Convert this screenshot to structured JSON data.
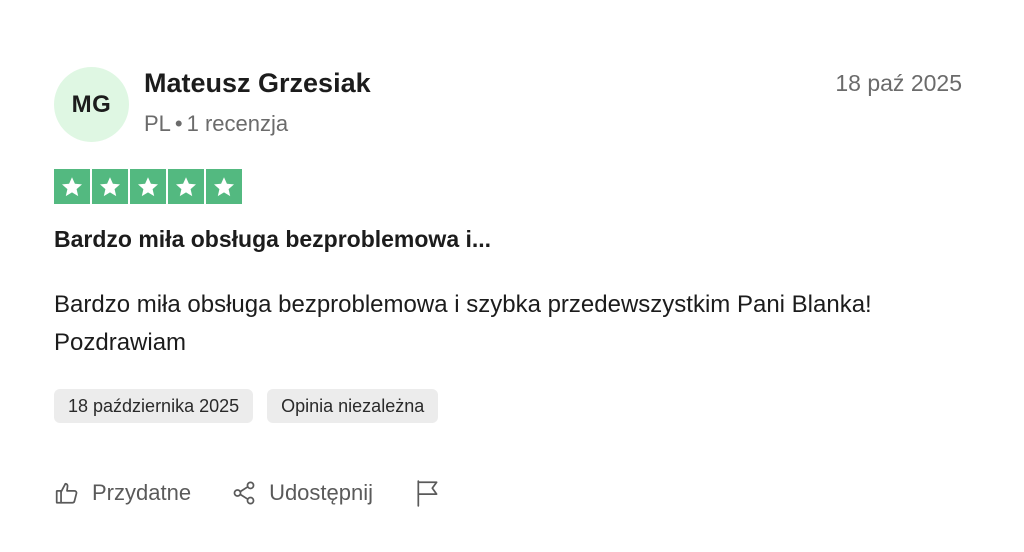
{
  "reviewer": {
    "initials": "MG",
    "name": "Mateusz Grzesiak",
    "country": "PL",
    "separator": "•",
    "review_count": "1 recenzja"
  },
  "review": {
    "date_short": "18 paź 2025",
    "rating": 5,
    "rating_max": 5,
    "title": "Bardzo miła obsługa bezproblemowa i...",
    "body": "Bardzo miła obsługa bezproblemowa i szybka przedewszystkim Pani Blanka! Pozdrawiam",
    "tags": [
      "18 października 2025",
      "Opinia niezależna"
    ]
  },
  "actions": {
    "useful_label": "Przydatne",
    "share_label": "Udostępnij",
    "useful_icon": "thumbs-up-icon",
    "share_icon": "share-icon",
    "report_icon": "flag-icon"
  },
  "colors": {
    "star_green": "#53b980",
    "avatar_bg": "#dff7e3",
    "tag_bg": "#ececec",
    "muted_text": "#6b6b6b"
  }
}
